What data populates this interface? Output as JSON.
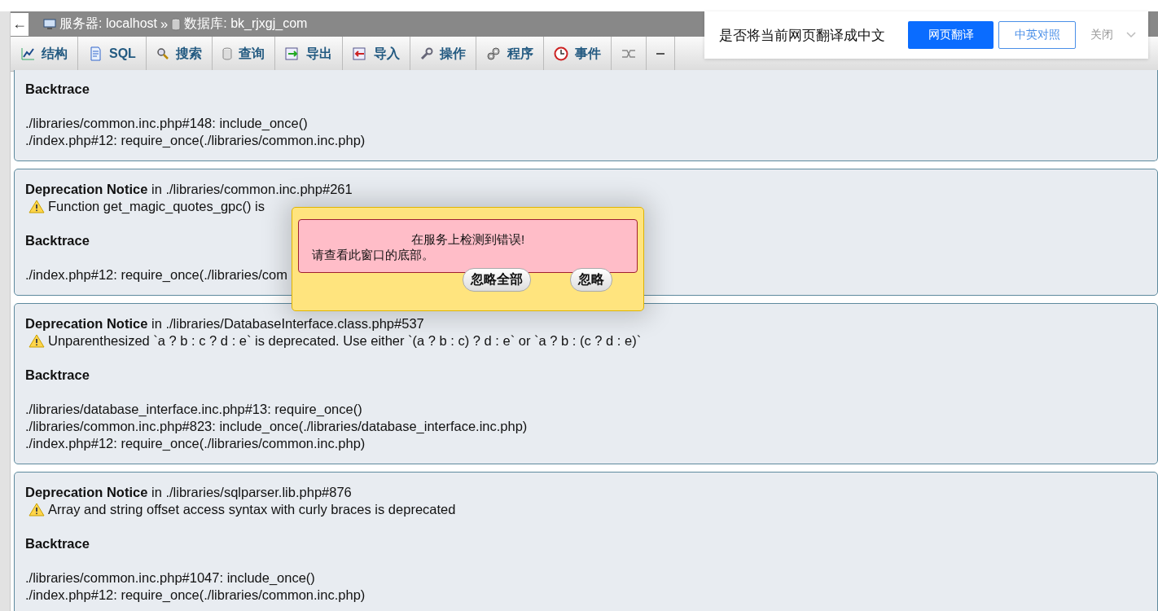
{
  "header": {
    "back": "←",
    "server_label": "服务器: localhost",
    "separator": "»",
    "database_label": "数据库: bk_rjxgj_com"
  },
  "tabs": [
    {
      "kind": "labeled",
      "label": "结构"
    },
    {
      "kind": "labeled",
      "label": "SQL"
    },
    {
      "kind": "labeled",
      "label": "搜索"
    },
    {
      "kind": "labeled",
      "label": "查询"
    },
    {
      "kind": "labeled",
      "label": "导出"
    },
    {
      "kind": "labeled",
      "label": "导入"
    },
    {
      "kind": "labeled",
      "label": "操作"
    },
    {
      "kind": "labeled",
      "label": "程序"
    },
    {
      "kind": "labeled",
      "label": "事件"
    },
    {
      "kind": "covered"
    },
    {
      "kind": "covered"
    }
  ],
  "notices": [
    {
      "backtrace_label": "Backtrace",
      "trace": [
        "./libraries/common.inc.php#148: include_once()",
        "./index.php#12: require_once(./libraries/common.inc.php)"
      ]
    },
    {
      "title": "Deprecation Notice",
      "location": "in ./libraries/common.inc.php#261",
      "message": "Function get_magic_quotes_gpc() is",
      "backtrace_label": "Backtrace",
      "trace": [
        "./index.php#12: require_once(./libraries/com"
      ]
    },
    {
      "title": "Deprecation Notice",
      "location": "in ./libraries/DatabaseInterface.class.php#537",
      "message": "Unparenthesized `a ? b : c ? d : e` is deprecated. Use either `(a ? b : c) ? d : e` or `a ? b : (c ? d : e)`",
      "backtrace_label": "Backtrace",
      "trace": [
        "./libraries/database_interface.inc.php#13: require_once()",
        "./libraries/common.inc.php#823: include_once(./libraries/database_interface.inc.php)",
        "./index.php#12: require_once(./libraries/common.inc.php)"
      ]
    },
    {
      "title": "Deprecation Notice",
      "location": "in ./libraries/sqlparser.lib.php#876",
      "message": "Array and string offset access syntax with curly braces is deprecated",
      "backtrace_label": "Backtrace",
      "trace": [
        "./libraries/common.inc.php#1047: include_once()",
        "./index.php#12: require_once(./libraries/common.inc.php)"
      ]
    }
  ],
  "error_dialog": {
    "heading": "在服务上检测到错误!",
    "text": "请查看此窗口的底部。",
    "buttons": [
      "忽略全部",
      "忽略"
    ]
  },
  "translate_bar": {
    "question": "是否将当前网页翻译成中文",
    "primary": "网页翻译",
    "secondary": "中英对照",
    "close": "关闭"
  }
}
